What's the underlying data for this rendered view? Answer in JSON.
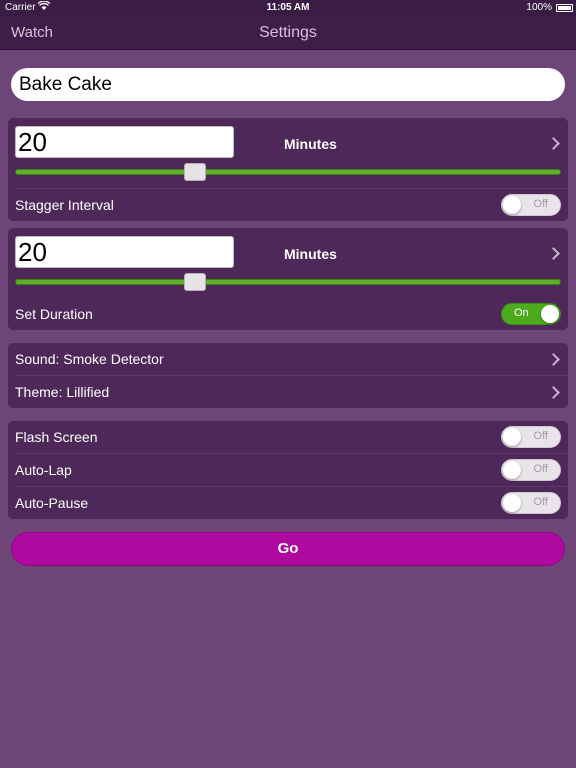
{
  "status_bar": {
    "carrier": "Carrier",
    "time": "11:05 AM",
    "battery": "100%"
  },
  "nav": {
    "back_label": "Watch",
    "title": "Settings"
  },
  "timer_name": {
    "value": "Bake Cake"
  },
  "stagger": {
    "value": "20",
    "unit": "Minutes",
    "slider_fraction": 0.33,
    "label": "Stagger Interval",
    "toggle": {
      "state": "off",
      "label": "Off"
    }
  },
  "duration": {
    "value": "20",
    "unit": "Minutes",
    "slider_fraction": 0.33,
    "label": "Set Duration",
    "toggle": {
      "state": "on",
      "label": "On"
    }
  },
  "options": {
    "sound_label": "Sound: Smoke Detector",
    "theme_label": "Theme: Lillified"
  },
  "toggles": [
    {
      "label": "Flash Screen",
      "state": "off",
      "state_label": "Off"
    },
    {
      "label": "Auto-Lap",
      "state": "off",
      "state_label": "Off"
    },
    {
      "label": "Auto-Pause",
      "state": "off",
      "state_label": "Off"
    }
  ],
  "go_button": {
    "label": "Go"
  },
  "colors": {
    "background": "#6e4577",
    "group": "#4d2858",
    "slider": "#5fb028",
    "toggle_on": "#4bab1d",
    "go_button": "#b0099f"
  }
}
